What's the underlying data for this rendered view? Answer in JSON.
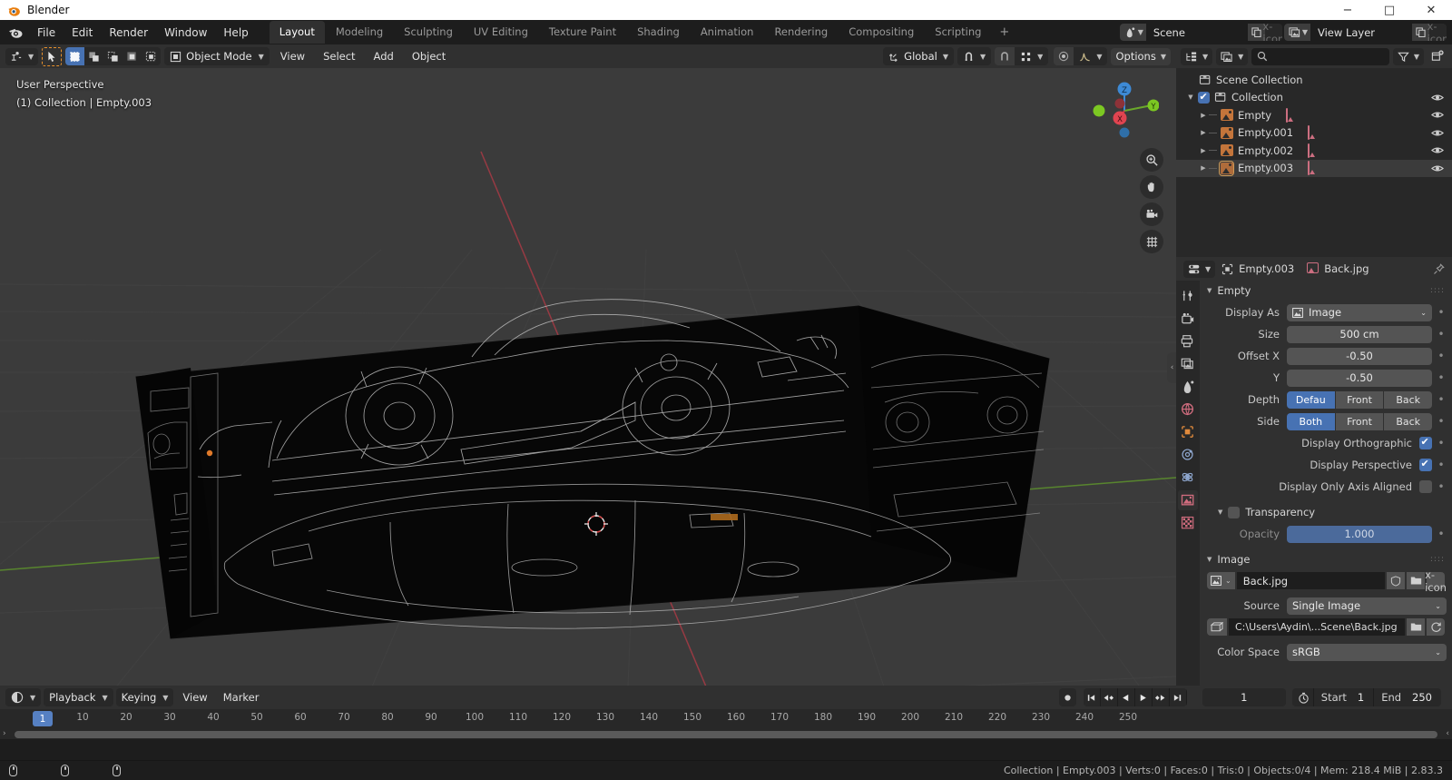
{
  "window": {
    "title": "Blender",
    "buttons": {
      "minimize": "−",
      "maximize": "□",
      "close": "✕"
    }
  },
  "topbar": {
    "menus": [
      "File",
      "Edit",
      "Render",
      "Window",
      "Help"
    ],
    "workspaces": [
      {
        "label": "Layout",
        "active": true
      },
      {
        "label": "Modeling",
        "active": false
      },
      {
        "label": "Sculpting",
        "active": false
      },
      {
        "label": "UV Editing",
        "active": false
      },
      {
        "label": "Texture Paint",
        "active": false
      },
      {
        "label": "Shading",
        "active": false
      },
      {
        "label": "Animation",
        "active": false
      },
      {
        "label": "Rendering",
        "active": false
      },
      {
        "label": "Compositing",
        "active": false
      },
      {
        "label": "Scripting",
        "active": false
      }
    ],
    "add_workspace": "+",
    "scene": {
      "name": "Scene",
      "icon": "scene-icon",
      "new_icon": "duplicate-icon",
      "unlink_icon": "x-icon"
    },
    "view_layer": {
      "name": "View Layer",
      "icon": "view-layer-icon",
      "new_icon": "duplicate-icon",
      "unlink_icon": "x-icon"
    }
  },
  "viewport_header": {
    "editor_type_icon": "editor-type-icon",
    "cursor_tool_icon": "cursor-tool-icon",
    "select_modes": [
      "set",
      "extend",
      "subtract",
      "invert",
      "intersect"
    ],
    "mode": "Object Mode",
    "menus": [
      "View",
      "Select",
      "Add",
      "Object"
    ],
    "transform_orientation": "Global",
    "snap_icon": "magnet-icon",
    "snap_target_icon": "snap-grid-icon",
    "proportional_icon": "proportional-edit-icon",
    "falloff_icon": "falloff-curve-icon",
    "options_label": "Options",
    "visibility_icon": "visibility-icon",
    "gizmo_icon": "gizmo-icon",
    "overlays_icon": "overlays-icon",
    "xray_icon": "xray-icon",
    "shading_modes": [
      "wireframe",
      "solid",
      "material-preview",
      "rendered"
    ],
    "shading_active": "wireframe"
  },
  "viewport": {
    "perspective_label": "User Perspective",
    "collection_label": "(1) Collection | Empty.003",
    "gizmo_axes": [
      "X",
      "Y",
      "Z"
    ],
    "nav_buttons": [
      "zoom-icon",
      "pan-hand-icon",
      "camera-icon",
      "grid-icon"
    ]
  },
  "outliner": {
    "header": {
      "display_mode_icon": "outliner-display-icon",
      "filter_id_icon": "filter-id-icon",
      "search_placeholder": "",
      "search_icon": "search-icon",
      "filter_icon": "filter-funnel-icon",
      "new_collection_icon": "new-collection-icon"
    },
    "rows": [
      {
        "label": "Scene Collection",
        "indent": 0,
        "icon": "collection-icon",
        "expand": "",
        "checkbox": false,
        "eye": false,
        "selected": false,
        "data_icon": null
      },
      {
        "label": "Collection",
        "indent": 1,
        "icon": "collection-icon",
        "expand": "▼",
        "checkbox": true,
        "eye": true,
        "selected": false,
        "data_icon": null
      },
      {
        "label": "Empty",
        "indent": 2,
        "icon": "empty-image-icon",
        "expand": "▶",
        "checkbox": false,
        "eye": true,
        "selected": false,
        "data_icon": "image-data-icon"
      },
      {
        "label": "Empty.001",
        "indent": 2,
        "icon": "empty-image-icon",
        "expand": "▶",
        "checkbox": false,
        "eye": true,
        "selected": false,
        "data_icon": "image-data-icon"
      },
      {
        "label": "Empty.002",
        "indent": 2,
        "icon": "empty-image-icon",
        "expand": "▶",
        "checkbox": false,
        "eye": true,
        "selected": false,
        "data_icon": "image-data-icon"
      },
      {
        "label": "Empty.003",
        "indent": 2,
        "icon": "empty-image-icon",
        "expand": "▶",
        "checkbox": false,
        "eye": true,
        "selected": true,
        "data_icon": "image-data-icon"
      }
    ]
  },
  "properties": {
    "editor_icon": "properties-editor-icon",
    "breadcrumb": {
      "object_icon": "object-icon",
      "object_name": "Empty.003",
      "data_icon": "image-data-icon",
      "data_name": "Back.jpg",
      "pin_icon": "pin-icon"
    },
    "tabs": [
      {
        "name": "tool",
        "icon": "tool-icon",
        "active": false
      },
      {
        "name": "render",
        "icon": "render-icon",
        "active": false
      },
      {
        "name": "output",
        "icon": "output-printer-icon",
        "active": false
      },
      {
        "name": "view-layer",
        "icon": "view-layer-icon",
        "active": false
      },
      {
        "name": "scene",
        "icon": "scene-cone-icon",
        "active": false
      },
      {
        "name": "world",
        "icon": "world-globe-icon",
        "active": false
      },
      {
        "name": "object",
        "icon": "object-square-icon",
        "active": false
      },
      {
        "name": "constraints",
        "icon": "constraints-icon",
        "active": false
      },
      {
        "name": "physics",
        "icon": "physics-icon",
        "active": false
      },
      {
        "name": "object-data",
        "icon": "image-data-icon",
        "active": true
      },
      {
        "name": "texture",
        "icon": "texture-checker-icon",
        "active": false
      }
    ],
    "empty_panel": {
      "title": "Empty",
      "display_as": {
        "label": "Display As",
        "value": "Image",
        "icon": "image-icon"
      },
      "size": {
        "label": "Size",
        "value": "500 cm"
      },
      "offset_x": {
        "label": "Offset X",
        "value": "-0.50"
      },
      "offset_y": {
        "label": "Y",
        "value": "-0.50"
      },
      "depth": {
        "label": "Depth",
        "options": [
          "Defau",
          "Front",
          "Back"
        ],
        "selected": "Defau"
      },
      "side": {
        "label": "Side",
        "options": [
          "Both",
          "Front",
          "Back"
        ],
        "selected": "Both"
      },
      "display_orthographic": {
        "label": "Display Orthographic",
        "checked": true
      },
      "display_perspective": {
        "label": "Display Perspective",
        "checked": true
      },
      "display_only_axis_aligned": {
        "label": "Display Only Axis Aligned",
        "checked": false
      }
    },
    "transparency_panel": {
      "title": "Transparency",
      "enabled": false,
      "opacity": {
        "label": "Opacity",
        "value": "1.000"
      }
    },
    "image_panel": {
      "title": "Image",
      "datablock": {
        "name": "Back.jpg",
        "browse_icon": "image-browse-icon",
        "fake_user_icon": "shield-icon",
        "open_icon": "folder-icon",
        "unlink_icon": "x-icon"
      },
      "source": {
        "label": "Source",
        "value": "Single Image"
      },
      "filepath": {
        "value": "C:\\Users\\Aydin\\...Scene\\Back.jpg",
        "icon": "filepath-icon",
        "open_icon": "folder-icon",
        "reload_icon": "reload-icon"
      },
      "color_space": {
        "label": "Color Space",
        "value": "sRGB"
      }
    }
  },
  "timeline": {
    "editor_icon": "timeline-editor-icon",
    "menus": [
      {
        "label": "Playback",
        "dropdown": true
      },
      {
        "label": "Keying",
        "dropdown": true
      },
      {
        "label": "View",
        "dropdown": false
      },
      {
        "label": "Marker",
        "dropdown": false
      }
    ],
    "transport": {
      "record_icon": "record-icon",
      "jump_start_icon": "jump-to-start-icon",
      "prev_keyframe_icon": "prev-keyframe-icon",
      "play_reverse_icon": "play-reverse-icon",
      "play_icon": "play-icon",
      "next_keyframe_icon": "next-keyframe-icon",
      "jump_end_icon": "jump-to-end-icon"
    },
    "current_frame": "1",
    "auto_key_icon": "stopwatch-icon",
    "start": {
      "label": "Start",
      "value": "1"
    },
    "end": {
      "label": "End",
      "value": "250"
    },
    "ticks": [
      "1",
      "10",
      "20",
      "30",
      "40",
      "50",
      "60",
      "70",
      "80",
      "90",
      "100",
      "110",
      "120",
      "130",
      "140",
      "150",
      "160",
      "170",
      "180",
      "190",
      "200",
      "210",
      "220",
      "230",
      "240",
      "250"
    ],
    "playhead_frame": "1"
  },
  "statusbar": {
    "mouse_hints": [
      "",
      "",
      ""
    ],
    "info": "Collection | Empty.003 | Verts:0 | Faces:0 | Tris:0 | Objects:0/4 | Mem: 218.4 MiB | 2.83.3"
  },
  "colors": {
    "accent_blue": "#4772b3",
    "blender_orange": "#e87d0d",
    "panel_bg": "#303030",
    "editor_bg": "#282828",
    "field_bg": "#545454",
    "viewport_bg": "#3b3b3b"
  }
}
